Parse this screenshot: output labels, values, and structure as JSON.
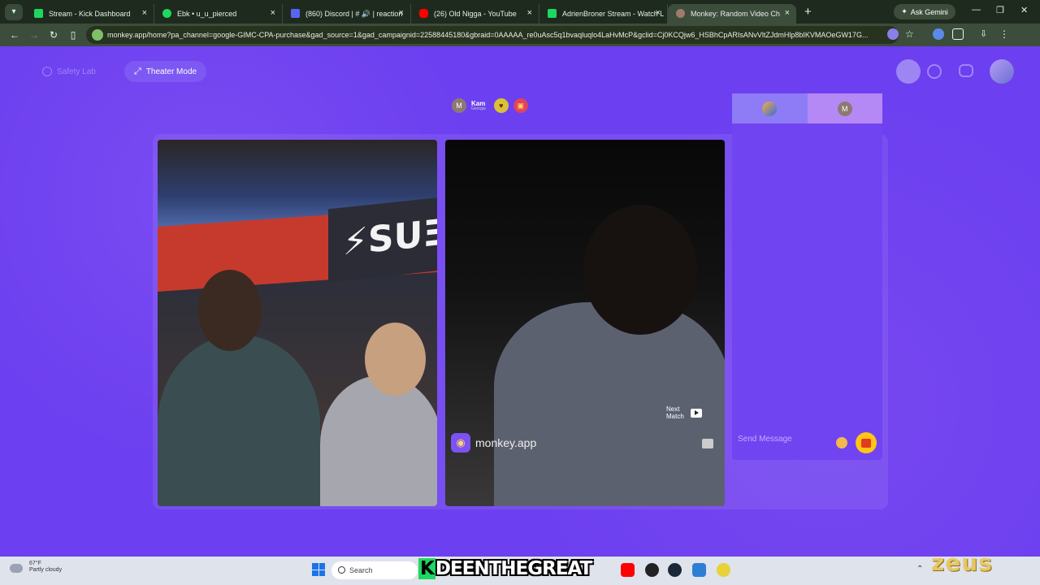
{
  "browser": {
    "tabs": [
      {
        "title": "Stream - Kick Dashboard",
        "favicon_color": "#1ed760"
      },
      {
        "title": "Ebk • u_u_pierced",
        "favicon_color": "#1ed760"
      },
      {
        "title": "(860) Discord | # 🔊 | reaction",
        "favicon_color": "#5865f2"
      },
      {
        "title": "(26) Old Nigga - YouTube",
        "favicon_color": "#ff0000"
      },
      {
        "title": "AdrienBroner Stream - Watch L",
        "favicon_color": "#1ed760"
      },
      {
        "title": "Monkey: Random Video Ch",
        "favicon_color": "#a07a6a"
      }
    ],
    "ask_gemini": "Ask Gemini",
    "url": "monkey.app/home?pa_channel=google-GIMC-CPA-purchase&gad_source=1&gad_campaignid=22588445180&gbraid=0AAAAA_re0uAsc5q1bvaqluqlo4LaHvMcP&gclid=Cj0KCQjw6_HSBhCpARIsANvVltZJdmHlp8bIKVMAOeGW17G..."
  },
  "page": {
    "safety_lab": "Safety Lab",
    "theater_mode": "Theater Mode",
    "peer": {
      "avatar_letter": "M",
      "name": "Kam",
      "location": "Georgia"
    },
    "brand": "monkey.app",
    "next_match": "Next\nMatch",
    "chat": {
      "tab2_letter": "M",
      "send_placeholder": "Send Message"
    }
  },
  "taskbar": {
    "weather_temp": "67°F",
    "weather_desc": "Partly cloudy",
    "search": "Search",
    "overlay_name": "DEENTHEGREAT",
    "overlay_k": "K",
    "zeus_watermark": "zeus"
  },
  "colors": {
    "page_bg": "#6c3ff0",
    "chat_bg": "#7144f2",
    "gift": "#ffc517"
  }
}
